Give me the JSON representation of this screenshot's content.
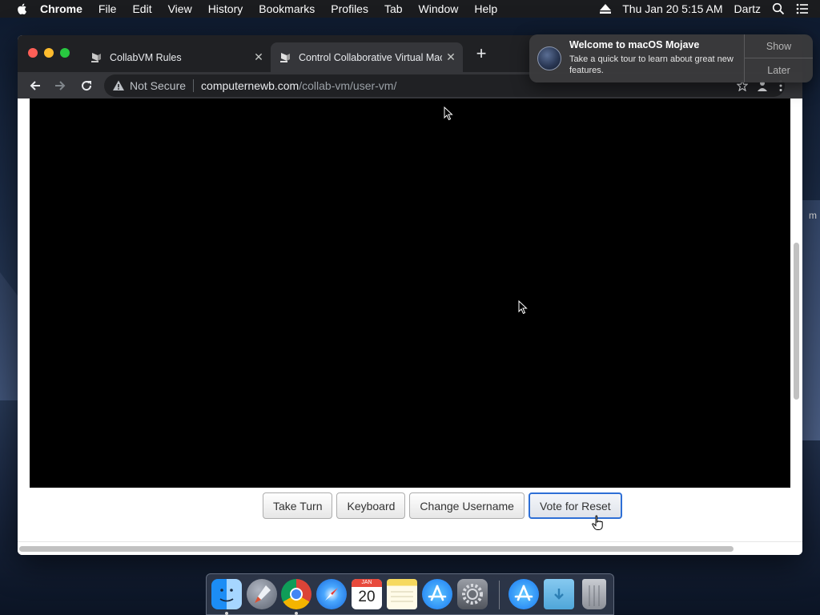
{
  "menubar": {
    "app_name": "Chrome",
    "items": [
      "File",
      "Edit",
      "View",
      "History",
      "Bookmarks",
      "Profiles",
      "Tab",
      "Window",
      "Help"
    ],
    "clock": "Thu Jan 20  5:15 AM",
    "user": "Dartz"
  },
  "tabs": [
    {
      "title": "CollabVM Rules",
      "favicon": "collabvm-icon",
      "active": false
    },
    {
      "title": "Control Collaborative Virtual Machines!",
      "favicon": "collabvm-icon",
      "active": true
    }
  ],
  "address_bar": {
    "security_label": "Not Secure",
    "host": "computernewb.com",
    "path": "/collab-vm/user-vm/"
  },
  "vm_controls": {
    "take_turn": "Take Turn",
    "keyboard": "Keyboard",
    "change_username": "Change Username",
    "vote_reset": "Vote for Reset"
  },
  "notification": {
    "title": "Welcome to macOS Mojave",
    "body": "Take a quick tour to learn about great new features.",
    "show_label": "Show",
    "later_label": "Later"
  },
  "desktop_edge_text": "m",
  "dock": {
    "calendar_month": "JAN",
    "calendar_day": "20",
    "items": [
      "finder-icon",
      "launchpad-icon",
      "chrome-icon",
      "safari-icon",
      "calendar-icon",
      "notes-icon",
      "app-store-icon",
      "system-preferences-icon",
      "app-store-downloads-icon",
      "downloads-folder-icon",
      "trash-icon"
    ]
  },
  "colors": {
    "tabstrip": "#202124",
    "toolbar": "#35363a",
    "vm_screen": "#000000",
    "focus_ring": "#2e6fd6"
  }
}
